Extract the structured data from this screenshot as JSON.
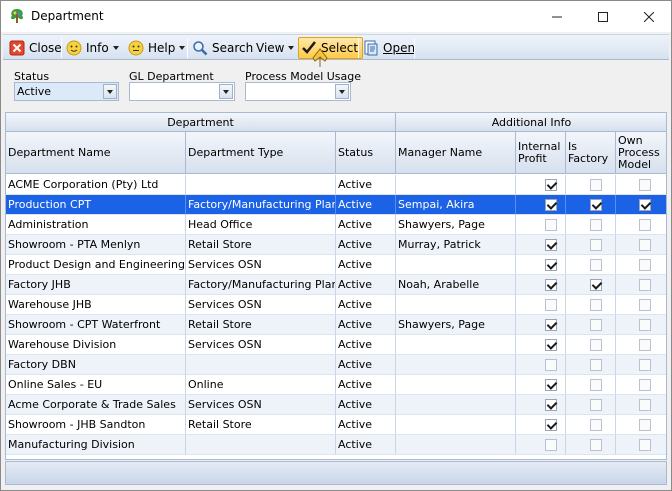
{
  "window": {
    "title": "Department",
    "icon": "department-tree-icon"
  },
  "toolbar": {
    "close_label": "Close",
    "info_label": "Info",
    "help_label": "Help",
    "search_label": "Search",
    "view_label": "View",
    "select_label": "Select",
    "open_label": "Open"
  },
  "filters": {
    "status_label": "Status",
    "status_value": "Active",
    "gl_department_label": "GL Department",
    "gl_department_value": "",
    "process_model_usage_label": "Process Model Usage",
    "process_model_usage_value": ""
  },
  "grid": {
    "bands": {
      "department": "Department",
      "additional_info": "Additional Info"
    },
    "columns": {
      "name": "Department Name",
      "type": "Department Type",
      "status": "Status",
      "manager": "Manager Name",
      "internal_profit_1": "Internal",
      "internal_profit_2": "Profit",
      "is_factory_1": "Is",
      "is_factory_2": "Factory",
      "own_pm_1": "Own",
      "own_pm_2": "Process",
      "own_pm_3": "Model"
    },
    "rows": [
      {
        "name": "ACME Corporation (Pty) Ltd",
        "type": "",
        "status": "Active",
        "manager": "",
        "internal": true,
        "factory": false,
        "own": false
      },
      {
        "name": "Production CPT",
        "type": "Factory/Manufacturing Plant",
        "status": "Active",
        "manager": "Sempai, Akira",
        "internal": true,
        "factory": true,
        "own": true
      },
      {
        "name": "Administration",
        "type": "Head Office",
        "status": "Active",
        "manager": "Shawyers, Page",
        "internal": false,
        "factory": false,
        "own": false
      },
      {
        "name": "Showroom - PTA Menlyn",
        "type": "Retail Store",
        "status": "Active",
        "manager": "Murray, Patrick",
        "internal": true,
        "factory": false,
        "own": false
      },
      {
        "name": "Product Design and Engineering",
        "type": "Services OSN",
        "status": "Active",
        "manager": "",
        "internal": true,
        "factory": false,
        "own": false
      },
      {
        "name": "Factory JHB",
        "type": "Factory/Manufacturing Plant",
        "status": "Active",
        "manager": "Noah, Arabelle",
        "internal": true,
        "factory": true,
        "own": false
      },
      {
        "name": "Warehouse JHB",
        "type": "Services OSN",
        "status": "Active",
        "manager": "",
        "internal": false,
        "factory": false,
        "own": false
      },
      {
        "name": "Showroom - CPT Waterfront",
        "type": "Retail Store",
        "status": "Active",
        "manager": "Shawyers, Page",
        "internal": true,
        "factory": false,
        "own": false
      },
      {
        "name": "Warehouse Division",
        "type": "Services OSN",
        "status": "Active",
        "manager": "",
        "internal": true,
        "factory": false,
        "own": false
      },
      {
        "name": "Factory DBN",
        "type": "",
        "status": "Active",
        "manager": "",
        "internal": false,
        "factory": false,
        "own": false
      },
      {
        "name": "Online Sales - EU",
        "type": "Online",
        "status": "Active",
        "manager": "",
        "internal": true,
        "factory": false,
        "own": false
      },
      {
        "name": "Acme Corporate & Trade Sales",
        "type": "Services OSN",
        "status": "Active",
        "manager": "",
        "internal": true,
        "factory": false,
        "own": false
      },
      {
        "name": "Showroom - JHB Sandton",
        "type": "Retail Store",
        "status": "Active",
        "manager": "",
        "internal": true,
        "factory": false,
        "own": false
      },
      {
        "name": "Manufacturing Division",
        "type": "",
        "status": "Active",
        "manager": "",
        "internal": false,
        "factory": false,
        "own": false
      }
    ],
    "selected_row_index": 1
  },
  "colors": {
    "selection": "#1c62e6",
    "toolbar_select_highlight": "#ffc94a",
    "header_gradient_top": "#f3f6fb",
    "header_gradient_bottom": "#d6e0ee"
  }
}
